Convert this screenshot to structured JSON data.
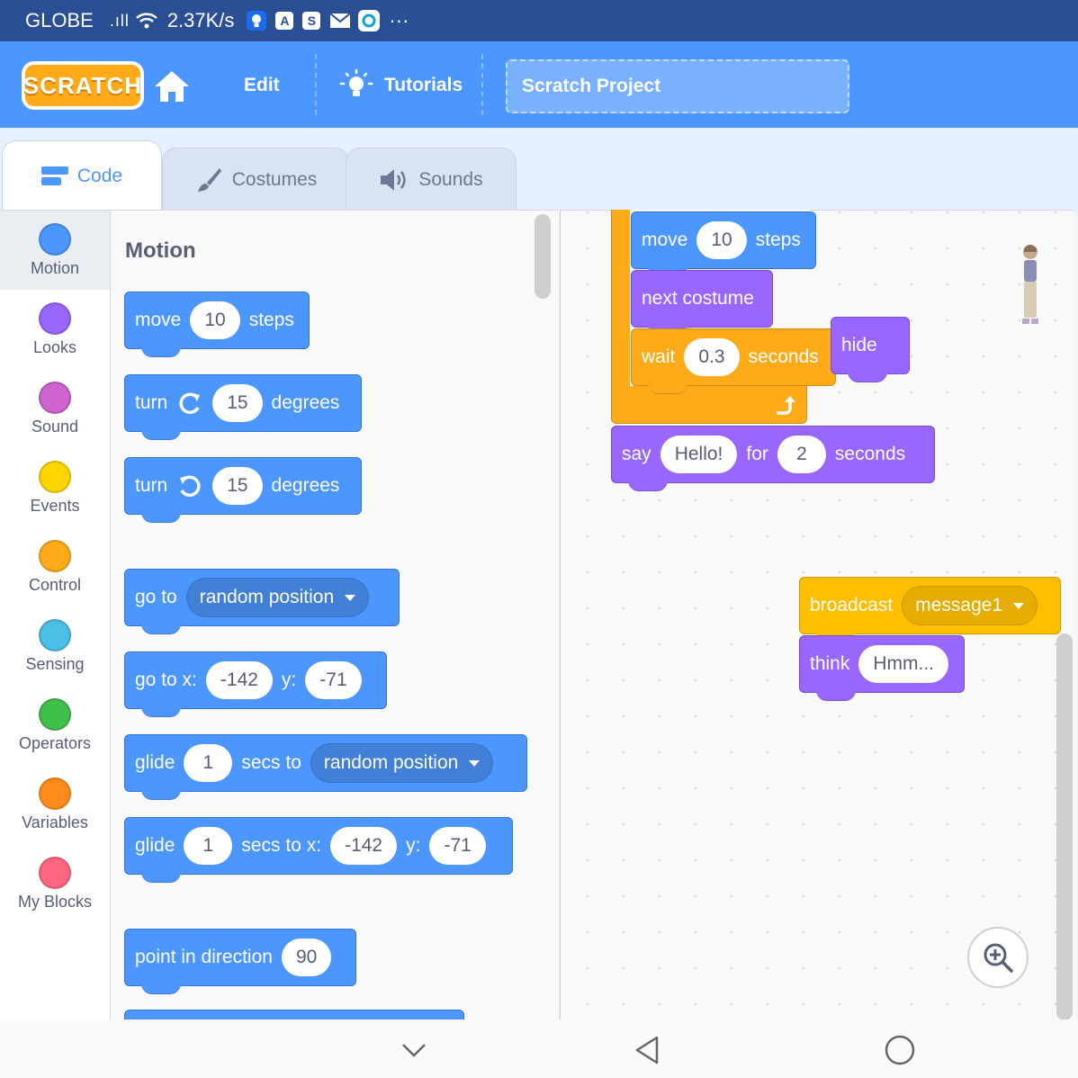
{
  "status_bar": {
    "carrier": "GLOBE",
    "signal": ".ıll",
    "speed": "2.37K/s",
    "notif_a": "A",
    "notif_s": "S",
    "more": "···"
  },
  "menu": {
    "logo_text": "SCRATCH",
    "edit_label": "Edit",
    "tutorials_label": "Tutorials",
    "project_title": "Scratch Project"
  },
  "tabs": {
    "code": "Code",
    "costumes": "Costumes",
    "sounds": "Sounds"
  },
  "categories": [
    {
      "label": "Motion",
      "color": "#4c97ff"
    },
    {
      "label": "Looks",
      "color": "#9966ff"
    },
    {
      "label": "Sound",
      "color": "#cf63cf"
    },
    {
      "label": "Events",
      "color": "#ffd500"
    },
    {
      "label": "Control",
      "color": "#ffab19"
    },
    {
      "label": "Sensing",
      "color": "#4cbfe6"
    },
    {
      "label": "Operators",
      "color": "#40bf4a"
    },
    {
      "label": "Variables",
      "color": "#ff8c1a"
    },
    {
      "label": "My Blocks",
      "color": "#ff6680"
    }
  ],
  "palette": {
    "heading": "Motion",
    "move": {
      "a": "move",
      "n": "10",
      "b": "steps"
    },
    "turn_cw": {
      "a": "turn",
      "n": "15",
      "b": "degrees"
    },
    "turn_ccw": {
      "a": "turn",
      "n": "15",
      "b": "degrees"
    },
    "goto": {
      "a": "go to",
      "opt": "random position"
    },
    "goto_xy": {
      "a": "go to x:",
      "x": "-142",
      "b": "y:",
      "y": "-71"
    },
    "glide": {
      "a": "glide",
      "n": "1",
      "b": "secs to",
      "opt": "random position"
    },
    "glide_xy": {
      "a": "glide",
      "n": "1",
      "b": "secs to x:",
      "x": "-142",
      "c": "y:",
      "y": "-71"
    },
    "point": {
      "a": "point in direction",
      "n": "90"
    }
  },
  "script": {
    "move": {
      "a": "move",
      "n": "10",
      "b": "steps"
    },
    "next_costume": "next costume",
    "wait": {
      "a": "wait",
      "n": "0.3",
      "b": "seconds"
    },
    "hide": "hide",
    "say": {
      "a": "say",
      "msg": "Hello!",
      "b": "for",
      "n": "2",
      "c": "seconds"
    },
    "broadcast": {
      "a": "broadcast",
      "opt": "message1"
    },
    "think": {
      "a": "think",
      "msg": "Hmm..."
    }
  },
  "colors": {
    "motion": "#4c97ff",
    "looks": "#9966ff",
    "control": "#ffab19",
    "events": "#ffbf00",
    "menu_bar": "#4c97ff",
    "status_bar": "#2a4f95"
  }
}
